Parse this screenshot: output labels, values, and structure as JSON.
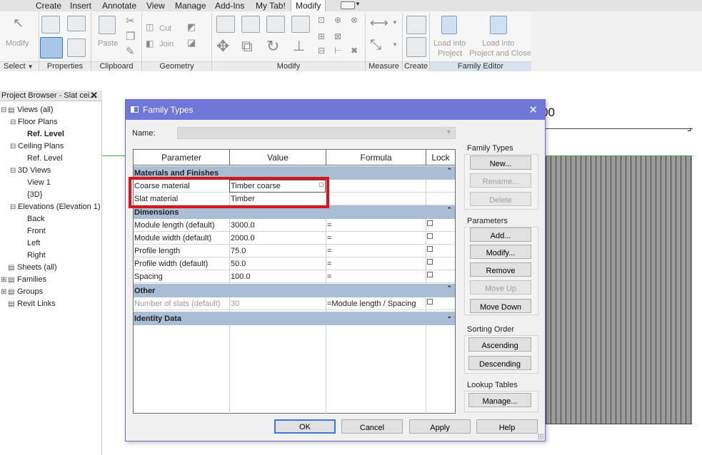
{
  "ribbon": {
    "tabs": [
      "Create",
      "Insert",
      "Annotate",
      "View",
      "Manage",
      "Add-Ins",
      "My Tab!",
      "Modify"
    ],
    "active_tab": "Modify",
    "buttons": {
      "modify": "Modify",
      "paste": "Paste",
      "cut": "Cut",
      "join": "Join",
      "load_into_project": [
        "Load into",
        "Project"
      ],
      "load_into_project_close": [
        "Load into",
        "Project and Close"
      ]
    },
    "panels": [
      "Select",
      "Properties",
      "Clipboard",
      "Geometry",
      "Modify",
      "Measure",
      "Create",
      "Family Editor"
    ]
  },
  "browser": {
    "title": "Project Browser - Slat cei...",
    "close_icon": "close-icon",
    "items": [
      {
        "label": "Views (all)",
        "level": 0,
        "toggle": "-"
      },
      {
        "label": "Floor Plans",
        "level": 1,
        "toggle": "-"
      },
      {
        "label": "Ref. Level",
        "level": 2,
        "bold": true
      },
      {
        "label": "Ceiling Plans",
        "level": 1,
        "toggle": "-"
      },
      {
        "label": "Ref. Level",
        "level": 2
      },
      {
        "label": "3D Views",
        "level": 1,
        "toggle": "-"
      },
      {
        "label": "View 1",
        "level": 2
      },
      {
        "label": "{3D}",
        "level": 2
      },
      {
        "label": "Elevations (Elevation 1)",
        "level": 1,
        "toggle": "-"
      },
      {
        "label": "Back",
        "level": 2
      },
      {
        "label": "Front",
        "level": 2
      },
      {
        "label": "Left",
        "level": 2
      },
      {
        "label": "Right",
        "level": 2
      },
      {
        "label": "Sheets (all)",
        "level": 0
      },
      {
        "label": "Families",
        "level": 0,
        "toggle": "+"
      },
      {
        "label": "Groups",
        "level": 0,
        "toggle": "+"
      },
      {
        "label": "Revit Links",
        "level": 0
      }
    ]
  },
  "canvas": {
    "label_fragment": "00"
  },
  "dialog": {
    "title": "Family Types",
    "name_label": "Name:",
    "name_value": "",
    "columns": [
      "Parameter",
      "Value",
      "Formula",
      "Lock"
    ],
    "groups": [
      {
        "label": "Materials and Finishes",
        "rows": [
          {
            "param": "Coarse material",
            "value": "Timber coarse",
            "formula": "",
            "lock": false,
            "has_lock": false,
            "editing": true
          },
          {
            "param": "Slat material",
            "value": "Timber",
            "formula": "",
            "lock": false,
            "has_lock": false
          }
        ]
      },
      {
        "label": "Dimensions",
        "rows": [
          {
            "param": "Module length (default)",
            "value": "3000.0",
            "formula": "=",
            "lock": false,
            "has_lock": true
          },
          {
            "param": "Module width (default)",
            "value": "2000.0",
            "formula": "=",
            "lock": false,
            "has_lock": true
          },
          {
            "param": "Profile length",
            "value": "75.0",
            "formula": "=",
            "lock": false,
            "has_lock": true
          },
          {
            "param": "Profile width (default)",
            "value": "50.0",
            "formula": "=",
            "lock": false,
            "has_lock": true
          },
          {
            "param": "Spacing",
            "value": "100.0",
            "formula": "=",
            "lock": false,
            "has_lock": true
          }
        ]
      },
      {
        "label": "Other",
        "rows": [
          {
            "param": "Number of slats (default)",
            "value": "30",
            "formula": "=Module length / Spacing",
            "lock": false,
            "has_lock": true,
            "dim": true
          }
        ]
      },
      {
        "label": "Identity Data",
        "rows": []
      }
    ],
    "family_types": {
      "title": "Family Types",
      "new": "New...",
      "rename": "Rename...",
      "delete": "Delete"
    },
    "parameters": {
      "title": "Parameters",
      "add": "Add...",
      "modify": "Modify...",
      "remove": "Remove",
      "move_up": "Move Up",
      "move_down": "Move Down"
    },
    "sorting": {
      "title": "Sorting Order",
      "ascending": "Ascending",
      "descending": "Descending"
    },
    "lookup": {
      "title": "Lookup Tables",
      "manage": "Manage..."
    },
    "footer": {
      "ok": "OK",
      "cancel": "Cancel",
      "apply": "Apply",
      "help": "Help"
    }
  },
  "colors": {
    "dialog_title_bar": "#6f78d8",
    "group_header": "#a9bdd4",
    "highlight": "#d9141b"
  }
}
